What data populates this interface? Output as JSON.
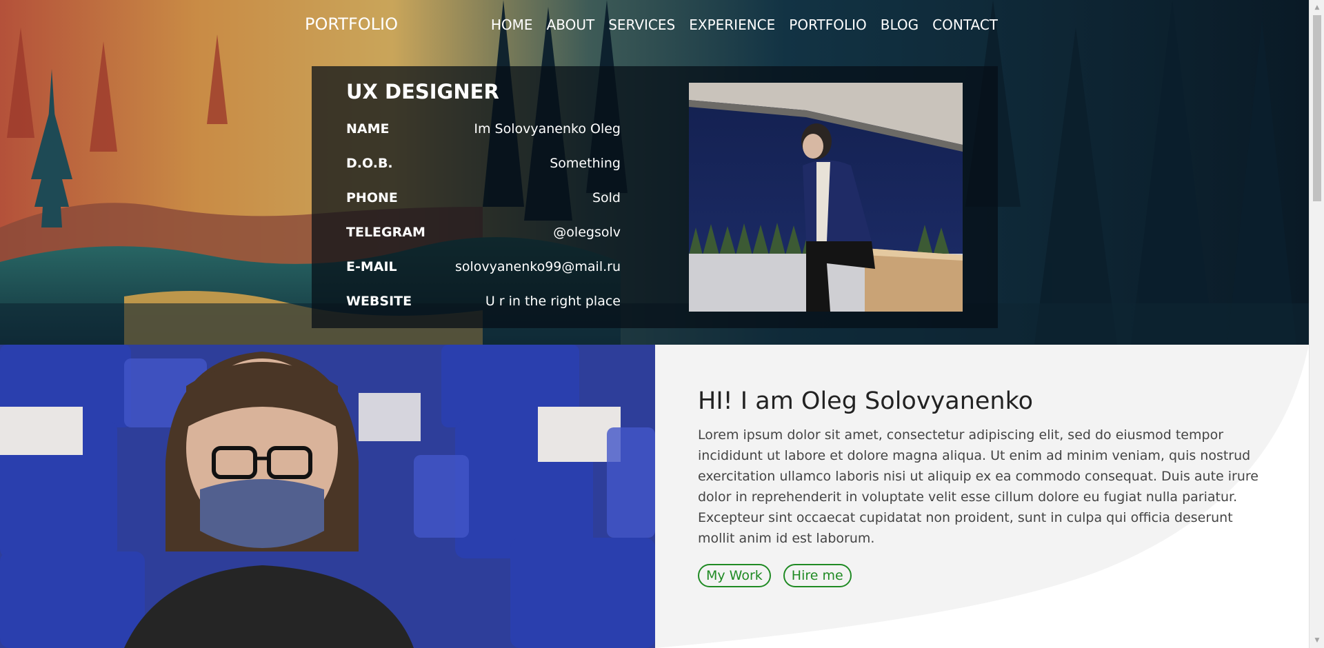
{
  "navbar": {
    "brand": "PORTFOLIO",
    "items": [
      {
        "label": "HOME"
      },
      {
        "label": "ABOUT"
      },
      {
        "label": "SERVICES"
      },
      {
        "label": "EXPERIENCE"
      },
      {
        "label": "PORTFOLIO"
      },
      {
        "label": "BLOG"
      },
      {
        "label": "CONTACT"
      }
    ]
  },
  "profile": {
    "role": "UX DESIGNER",
    "rows": [
      {
        "label": "NAME",
        "value": "Im Solovyanenko Oleg"
      },
      {
        "label": "D.O.B.",
        "value": "Something"
      },
      {
        "label": "PHONE",
        "value": "Sold"
      },
      {
        "label": "TELEGRAM",
        "value": "@olegsolv"
      },
      {
        "label": "E-MAIL",
        "value": "solovyanenko99@mail.ru"
      },
      {
        "label": "WEBSITE",
        "value": "U r in the right place"
      }
    ]
  },
  "about": {
    "title": "HI! I am Oleg Solovyanenko",
    "body": "Lorem ipsum dolor sit amet, consectetur adipiscing elit, sed do eiusmod tempor incididunt ut labore et dolore magna aliqua. Ut enim ad minim veniam, quis nostrud exercitation ullamco laboris nisi ut aliquip ex ea commodo consequat. Duis aute irure dolor in reprehenderit in voluptate velit esse cillum dolore eu fugiat nulla pariatur. Excepteur sint occaecat cupidatat non proident, sunt in culpa qui officia deserunt mollit anim id est laborum.",
    "buttons": {
      "work": "My Work",
      "hire": "Hire me"
    }
  },
  "colors": {
    "accent": "#1f8a23",
    "hero_overlay": "#050e16",
    "about_bg": "#f3f3f3"
  },
  "icons": {
    "scroll_up": "scroll-up-arrow-icon",
    "scroll_down": "scroll-down-arrow-icon"
  }
}
